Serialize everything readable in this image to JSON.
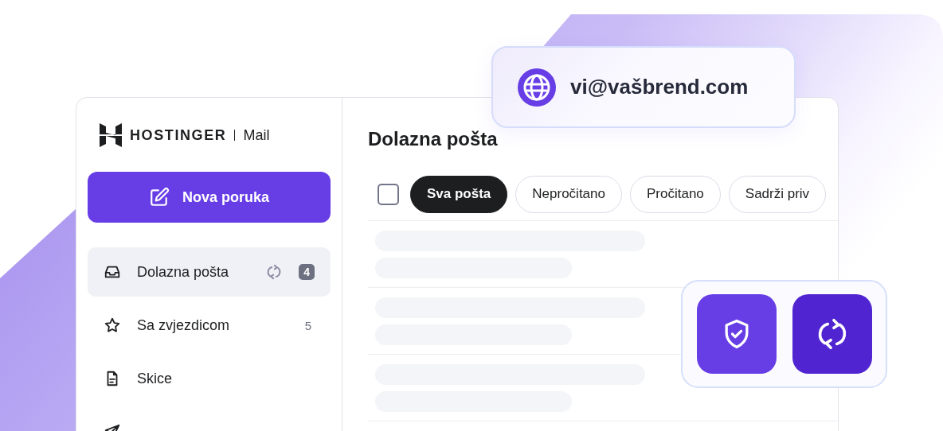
{
  "brand": {
    "name": "HOSTINGER",
    "product": "Mail"
  },
  "compose_button": {
    "label": "Nova poruka"
  },
  "sidebar": {
    "items": [
      {
        "kind": "inbox",
        "label": "Dolazna pošta",
        "count": "4",
        "syncing": true,
        "selected": true
      },
      {
        "kind": "starred",
        "label": "Sa zvjezdicom",
        "count": "5",
        "syncing": false,
        "selected": false
      },
      {
        "kind": "drafts",
        "label": "Skice",
        "syncing": false,
        "selected": false
      },
      {
        "kind": "sent",
        "syncing": false,
        "selected": false
      }
    ]
  },
  "main": {
    "title": "Dolazna pošta",
    "select_all": {
      "checked": false
    },
    "filters": [
      {
        "label": "Sva pošta",
        "selected": true
      },
      {
        "label": "Nepročitano",
        "selected": false
      },
      {
        "label": "Pročitano",
        "selected": false
      },
      {
        "label": "Sadrži priv",
        "selected": false
      }
    ],
    "messages": [
      {
        "kind": "skeleton"
      },
      {
        "kind": "skeleton"
      },
      {
        "kind": "skeleton"
      }
    ]
  },
  "email_card": {
    "address": "vi@vašbrend.com"
  },
  "feature_buttons": [
    {
      "kind": "security"
    },
    {
      "kind": "sync"
    }
  ]
}
